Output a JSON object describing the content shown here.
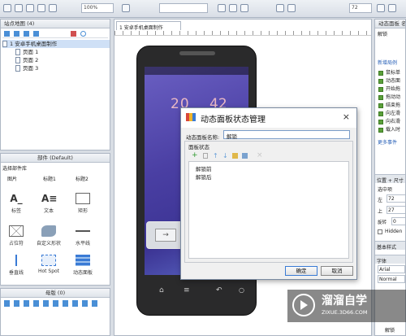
{
  "toolbar": {
    "zoom": "100%",
    "zoom_right": "72"
  },
  "sitemap": {
    "title": "站点地图 (4)",
    "root": "1 安卓手机桌面制作",
    "pages": [
      "页面 1",
      "页面 2",
      "页面 3"
    ]
  },
  "widgets": {
    "title": "部件 (Default)",
    "lib_selector": "选择部件库",
    "categories": [
      "图片",
      "标题1",
      "标题2"
    ],
    "items": [
      "标签",
      "文本",
      "矩形",
      "占位符",
      "自定义形状",
      "水平线",
      "垂直线",
      "Hot Spot",
      "动态面板"
    ]
  },
  "masters": {
    "title": "母版 (0)"
  },
  "canvas": {
    "tab": "1 安卓手机桌面制作",
    "clock_h": "20",
    "clock_m": "42"
  },
  "dialog": {
    "title": "动态面板状态管理",
    "name_label": "动态面板名称:",
    "name_value": "解锁",
    "states_label": "面板状态",
    "states": [
      "解锁前",
      "解锁后"
    ],
    "ok_label": "确定",
    "cancel_label": "取消",
    "close_glyph": "×"
  },
  "right_panel": {
    "title": "动态面板 名称",
    "subtitle": "解锁",
    "section_new": "新增局例",
    "more_events": "更多事件",
    "events": [
      "鼠标单",
      "动态面",
      "开始拖",
      "拖动动",
      "结束拖",
      "向左滑",
      "向右滑",
      "载入时"
    ],
    "position_title": "位置 + 尺寸",
    "selected": "选中项",
    "left_label": "左",
    "left_value": "72",
    "top_label": "上",
    "top_value": "27",
    "rot_label": "旋转",
    "rot_value": "0",
    "hidden_label": "Hidden",
    "basic_style": "基本样式",
    "font_title": "字体",
    "font_value": "Arial",
    "font_style": "Normal",
    "bottom_item": "解锁"
  },
  "watermark": {
    "brand": "溜溜自学",
    "url": "ZIXUE.3D66.COM"
  }
}
